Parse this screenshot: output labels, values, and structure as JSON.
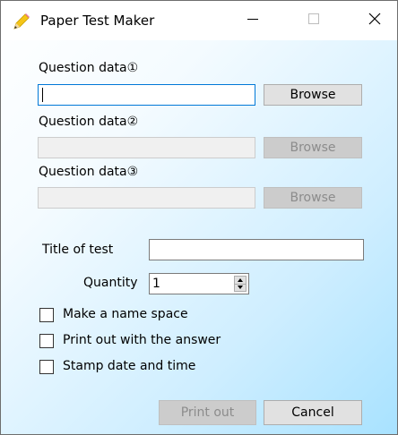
{
  "window": {
    "title": "Paper Test Maker",
    "icon": "pencil-icon",
    "controls": {
      "minimize": "minimize-icon",
      "maximize": "maximize-icon",
      "close": "close-icon"
    }
  },
  "questions": [
    {
      "label": "Question data①",
      "value": "",
      "browse_label": "Browse",
      "enabled": true
    },
    {
      "label": "Question data②",
      "value": "",
      "browse_label": "Browse",
      "enabled": false
    },
    {
      "label": "Question data③",
      "value": "",
      "browse_label": "Browse",
      "enabled": false
    }
  ],
  "title_of_test": {
    "label": "Title of test",
    "value": ""
  },
  "quantity": {
    "label": "Quantity",
    "value": "1"
  },
  "options": [
    {
      "label": "Make a name space",
      "checked": false
    },
    {
      "label": "Print out with the answer",
      "checked": false
    },
    {
      "label": "Stamp date and time",
      "checked": false
    }
  ],
  "buttons": {
    "print_label": "Print out",
    "print_enabled": false,
    "cancel_label": "Cancel"
  },
  "colors": {
    "accent": "#0078d7",
    "disabled_bg": "#cccccc",
    "disabled_text": "#8c8c8c",
    "button_bg": "#e1e1e1"
  }
}
